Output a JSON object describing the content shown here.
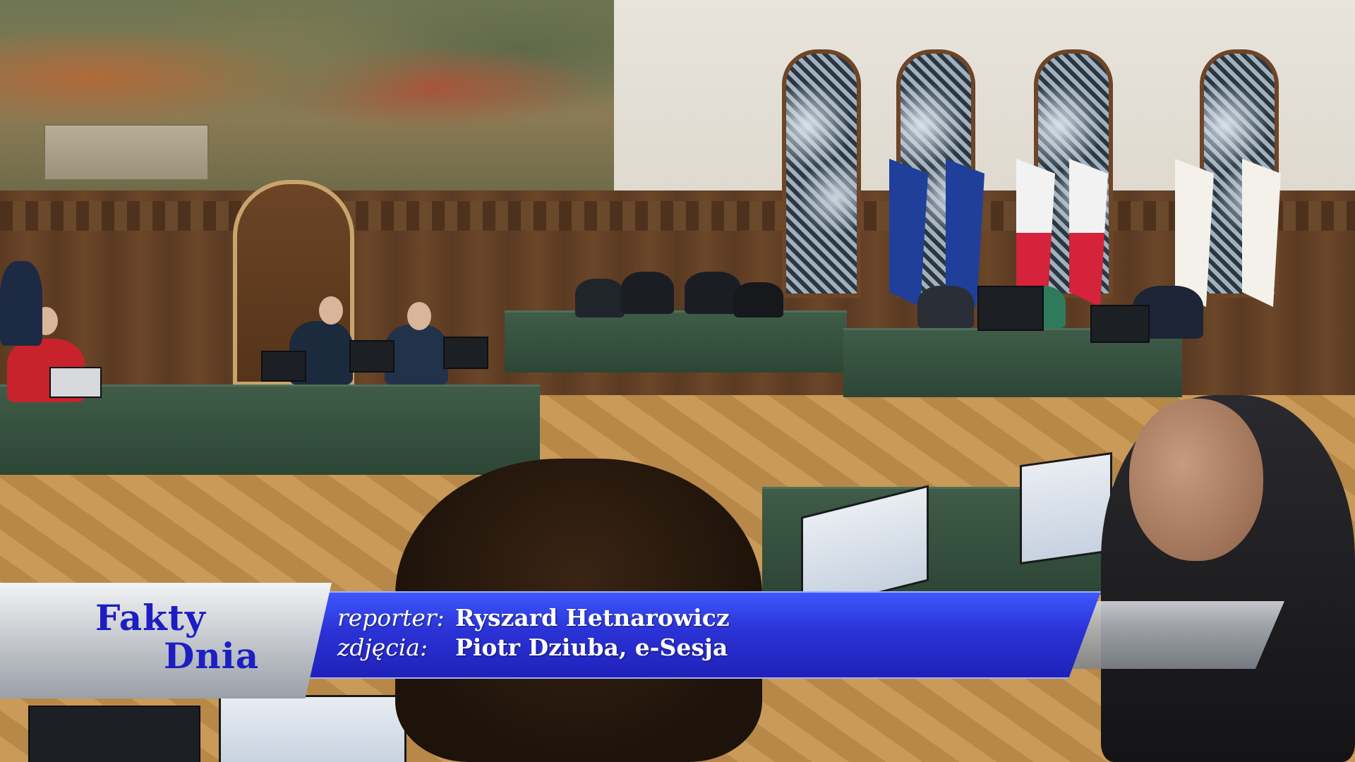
{
  "logo": {
    "line1": "Fakty",
    "line2": "Dnia"
  },
  "caption": {
    "reporter_label": "reporter:",
    "reporter_value": "Ryszard Hetnarowicz",
    "photos_label": "zdjęcia:",
    "photos_value": "Piotr Dziuba, e-Sesja"
  },
  "colors": {
    "caption_blue": "#2b33d6",
    "logo_text": "#1c1ec2"
  }
}
